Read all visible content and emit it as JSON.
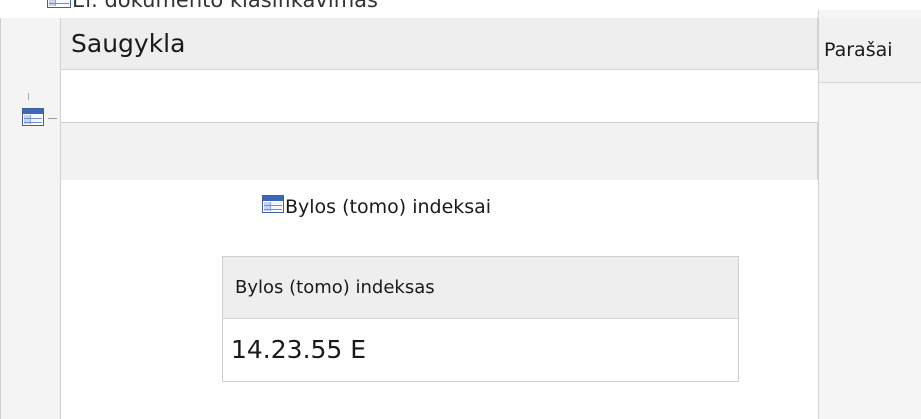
{
  "top_caption": "El. dokumento klasifikavimas",
  "saugykla": {
    "label": "Saugykla"
  },
  "right_column": {
    "label": "Parašai"
  },
  "bylos_section": {
    "caption": "Bylos (tomo) indeksai",
    "table": {
      "header": "Bylos (tomo) indeksas",
      "rows": [
        {
          "value": "14.23.55 E"
        }
      ]
    }
  },
  "colors": {
    "header_bg": "#eeeeee",
    "gutter_bg": "#f4f4f4",
    "icon_blue": "#3d67b8",
    "border": "#d2d2d2"
  },
  "icons": [
    "grid-table-icon"
  ]
}
